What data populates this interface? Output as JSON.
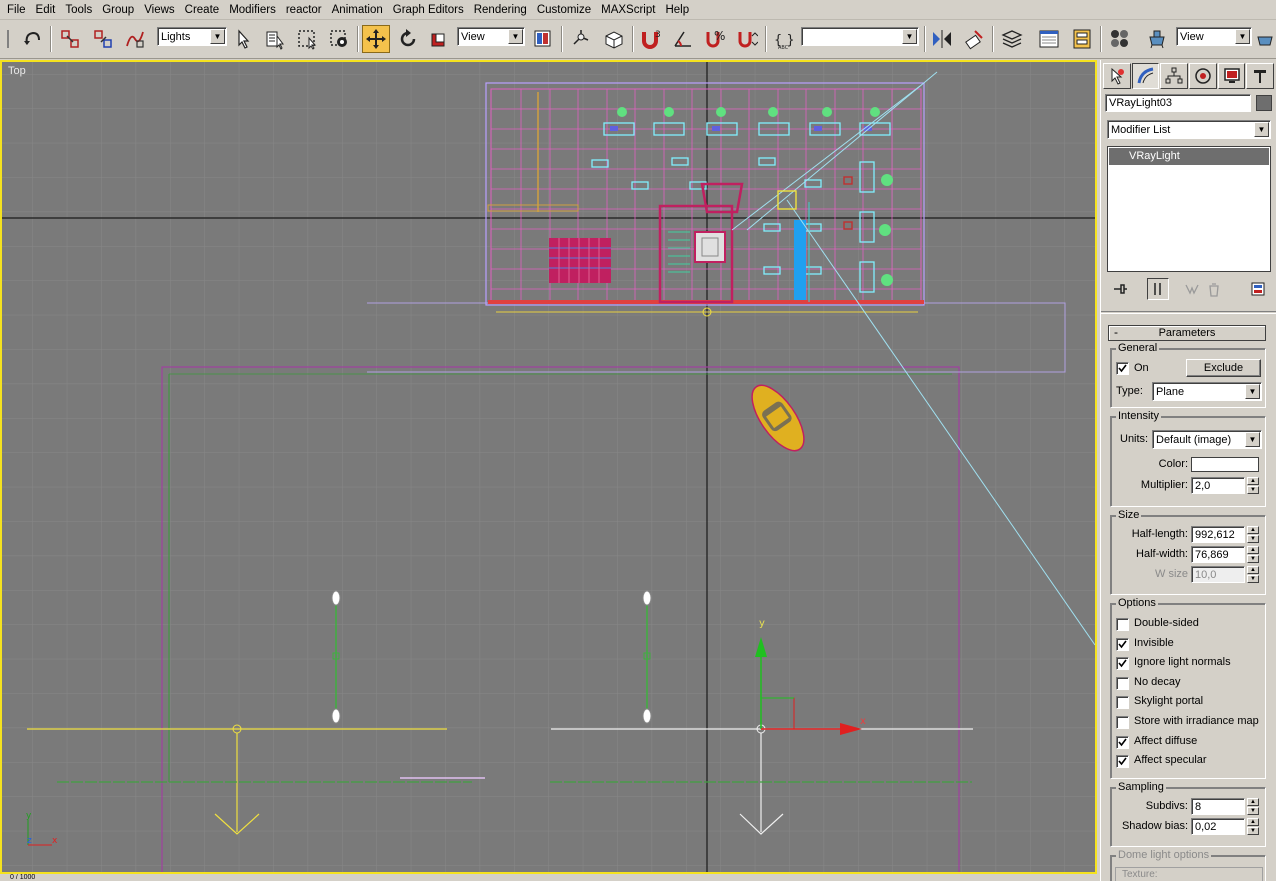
{
  "menu": [
    "File",
    "Edit",
    "Tools",
    "Group",
    "Views",
    "Create",
    "Modifiers",
    "reactor",
    "Animation",
    "Graph Editors",
    "Rendering",
    "Customize",
    "MAXScript",
    "Help"
  ],
  "toolbar": {
    "selection_filter": "Lights",
    "ref_coord": "View",
    "named_selection": "",
    "render_view": "View"
  },
  "viewport": {
    "label": "Top",
    "axis_y": "y",
    "axis_x": "x",
    "tri_y": "y",
    "tri_z": "z",
    "tri_x": "x"
  },
  "status": {
    "frame_counter": "0 / 1000"
  },
  "panel": {
    "object_name": "VRayLight03",
    "object_color": "#6e6e6e",
    "modifier_list": "Modifier List",
    "stack_item": "VRayLight",
    "rollout_title": "Parameters",
    "rollout_minus": "-",
    "general": {
      "title": "General",
      "on_label": "On",
      "on_checked": true,
      "exclude_label": "Exclude",
      "type_label": "Type:",
      "type_value": "Plane"
    },
    "intensity": {
      "title": "Intensity",
      "units_label": "Units:",
      "units_value": "Default (image)",
      "color_label": "Color:",
      "color_value": "#ffffff",
      "multiplier_label": "Multiplier:",
      "multiplier_value": "2,0"
    },
    "size": {
      "title": "Size",
      "half_length_label": "Half-length:",
      "half_length_value": "992,612",
      "half_width_label": "Half-width:",
      "half_width_value": "76,869",
      "wsize_label": "W size",
      "wsize_value": "10,0"
    },
    "options": {
      "title": "Options",
      "items": [
        {
          "label": "Double-sided",
          "checked": false
        },
        {
          "label": "Invisible",
          "checked": true
        },
        {
          "label": "Ignore light normals",
          "checked": true
        },
        {
          "label": "No decay",
          "checked": false
        },
        {
          "label": "Skylight portal",
          "checked": false
        },
        {
          "label": "Store with irradiance map",
          "checked": false
        },
        {
          "label": "Affect diffuse",
          "checked": true
        },
        {
          "label": "Affect specular",
          "checked": true
        }
      ]
    },
    "sampling": {
      "title": "Sampling",
      "subdivs_label": "Subdivs:",
      "subdivs_value": "8",
      "shadow_bias_label": "Shadow bias:",
      "shadow_bias_value": "0,02"
    },
    "dome": {
      "title": "Dome light options",
      "texture_label": "Texture:"
    }
  },
  "colors": {
    "viewport_bg": "#7a7a7a",
    "grid": "#8a8a8a",
    "active_border": "#f5e21e",
    "selected_tool": "#f4c24c"
  }
}
